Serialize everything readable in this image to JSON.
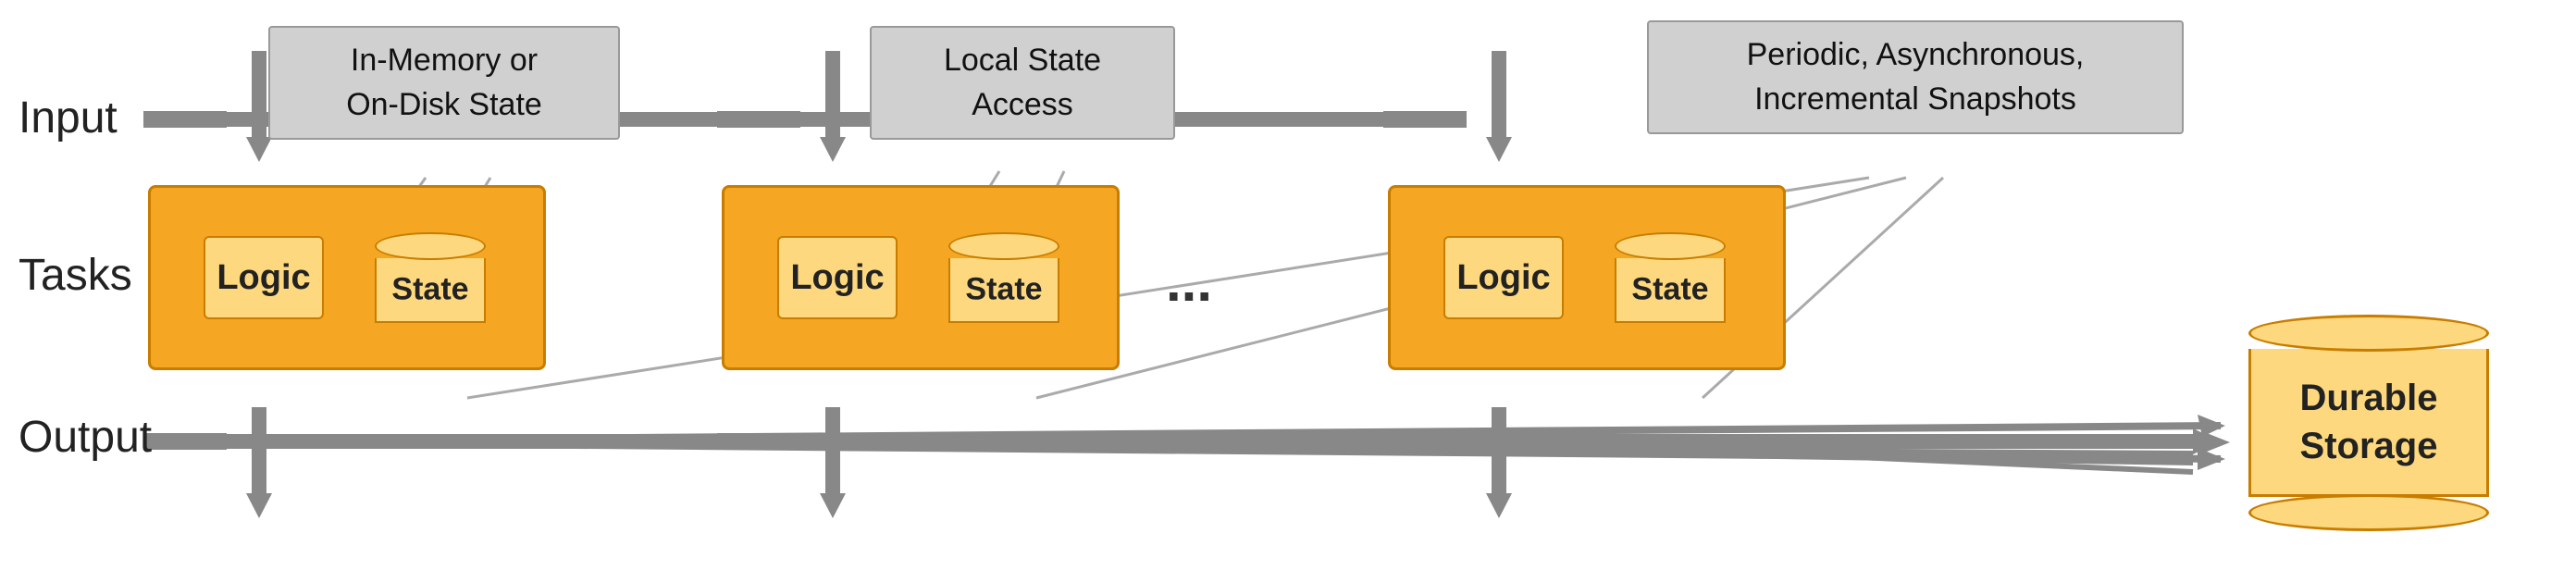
{
  "labels": {
    "input": "Input",
    "tasks": "Tasks",
    "output": "Output"
  },
  "callouts": {
    "inmemory": {
      "line1": "In-Memory or",
      "line2": "On-Disk State"
    },
    "localstate": {
      "line1": "Local State",
      "line2": "Access"
    },
    "snapshots": {
      "line1": "Periodic, Asynchronous,",
      "line2": "Incremental Snapshots"
    }
  },
  "task_boxes": [
    {
      "logic": "Logic",
      "state": "State"
    },
    {
      "logic": "Logic",
      "state": "State"
    },
    {
      "logic": "Logic",
      "state": "State"
    }
  ],
  "ellipsis": "...",
  "durable_storage": {
    "label1": "Durable",
    "label2": "Storage"
  }
}
